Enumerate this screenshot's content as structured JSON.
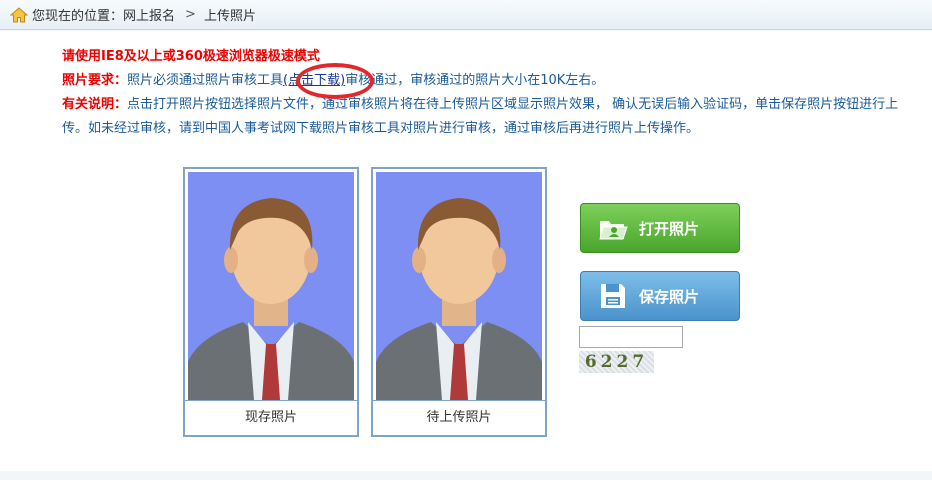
{
  "breadcrumb": {
    "prefix": "您现在的位置：",
    "parent": "网上报名",
    "separator": ">",
    "current": "上传照片"
  },
  "notice": {
    "browser_tip": "请使用IE8及以上或360极速浏览器极速模式",
    "req_label": "照片要求：",
    "req_text_before": "照片必须通过照片审核工具",
    "download_link": "(点击下载)",
    "req_text_after": "审核通过，审核通过的照片大小在10K左右。",
    "info_label": "有关说明：",
    "info_text": "点击打开照片按钮选择照片文件，通过审核照片将在待上传照片区域显示照片效果， 确认无误后输入验证码，单击保存照片按钮进行上传。如未经过审核，请到中国人事考试网下载照片审核工具对照片进行审核，通过审核后再进行照片上传操作。"
  },
  "photos": {
    "current_caption": "现存照片",
    "pending_caption": "待上传照片"
  },
  "buttons": {
    "open_label": "打开照片",
    "save_label": "保存照片"
  },
  "captcha": {
    "input_value": "",
    "image_text": "6227"
  },
  "colors": {
    "photo_bg": "#7d8ff3",
    "open_button": "#5cb83c",
    "save_button": "#5aa3d8",
    "highlight_circle": "#e3282b"
  }
}
